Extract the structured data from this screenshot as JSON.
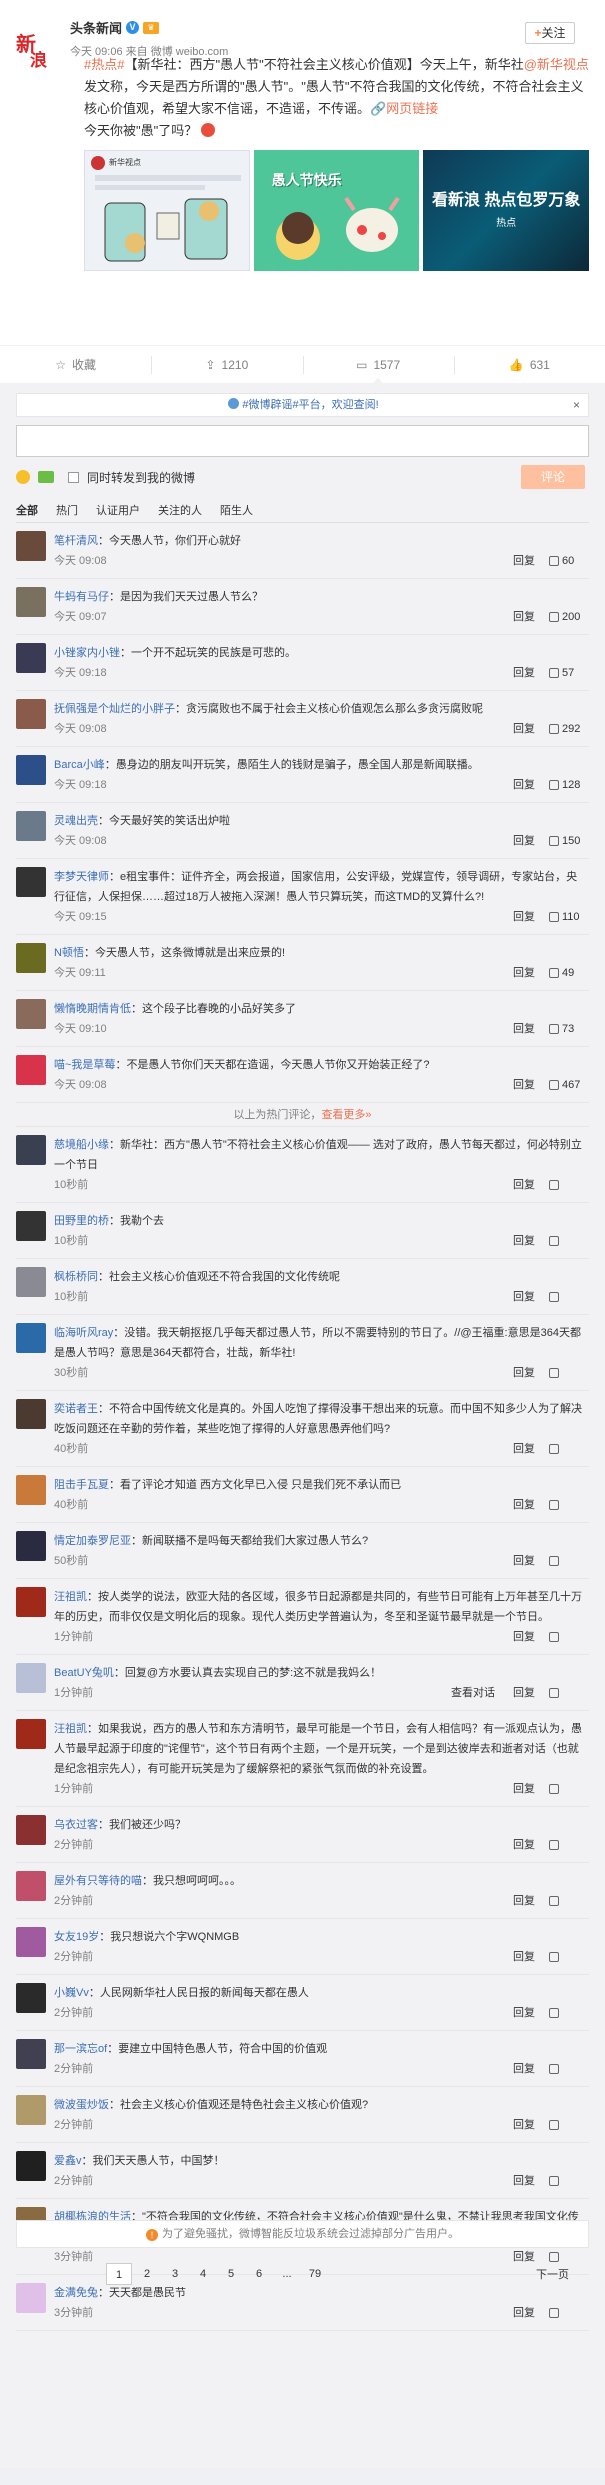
{
  "post": {
    "author": "头条新闻",
    "logo_text_1": "新",
    "logo_text_2": "浪",
    "meta": "今天 09:06 来自 微博 weibo.com",
    "follow_label": "关注",
    "text_parts": [
      "#热点#",
      "【新华社：西方\"愚人节\"不符社会主义核心价值观】今天上午，新华社",
      "@新华视点",
      " 发文称，今天是西方所谓的\"愚人节\"。\"愚人节\"不符合我国的文化传统，不符合社会主义核心价值观，希望大家不信谣，不造谣，不传谣。",
      "网页链接",
      "今天你被\"愚\"了吗？"
    ],
    "image2_text": "愚人节快乐",
    "image3_text": "看新浪 热点包罗万象",
    "image3_sub": "热点",
    "image1_header": "新华视点",
    "actions": {
      "favorite": "收藏",
      "repost": "1210",
      "comment": "1577",
      "like": "631"
    }
  },
  "comments": {
    "notice": "#微博辟谣#平台，欢迎查阅!",
    "notice_close": "×",
    "also_repost": "同时转发到我的微博",
    "submit": "评论",
    "tabs": [
      "全部",
      "热门",
      "认证用户",
      "关注的人",
      "陌生人"
    ],
    "reply": "回复",
    "view_conv": "查看对话",
    "hot": [
      {
        "name": "笔杆清风",
        "text": "今天愚人节，你们开心就好",
        "time": "今天 09:08",
        "likes": "60",
        "av": "#6a4a3a"
      },
      {
        "name": "牛蚂有马仔",
        "text": "是因为我们天天过愚人节么？",
        "time": "今天 09:07",
        "likes": "200",
        "av": "#7a7060"
      },
      {
        "name": "小锉家内小锉",
        "text": "一个开不起玩笑的民族是可悲的。",
        "time": "今天 09:18",
        "likes": "57",
        "av": "#3a3a55"
      },
      {
        "name": "抚佩强是个灿烂的小胖子",
        "text": "贪污腐败也不属于社会主义核心价值观怎么那么多贪污腐败呢",
        "time": "今天 09:08",
        "likes": "292",
        "av": "#8a5a4a"
      },
      {
        "name": "Barca小峰",
        "text": "愚身边的朋友叫开玩笑，愚陌生人的钱财是骗子，愚全国人那是新闻联播。",
        "time": "今天 09:18",
        "likes": "128",
        "av": "#2c4f8a"
      },
      {
        "name": "灵魂出壳",
        "text": "今天最好笑的笑话出炉啦",
        "time": "今天 09:08",
        "likes": "150",
        "av": "#6a7a8a"
      },
      {
        "name": "李梦天律师",
        "text": "e租宝事件：证件齐全，两会报道，国家信用，公安评级，党媒宣传，领导调研，专家站台，央行征信，人保担保……超过18万人被拖入深渊！愚人节只算玩笑，而这TMD的叉算什么?!",
        "time": "今天 09:15",
        "likes": "110",
        "av": "#333333"
      },
      {
        "name": "N顿悟",
        "text": "今天愚人节，这条微博就是出来应景的!",
        "time": "今天 09:11",
        "likes": "49",
        "av": "#6a6a20"
      },
      {
        "name": "懒惰晚期情肯低",
        "text": "这个段子比春晚的小品好笑多了",
        "time": "今天 09:10",
        "likes": "73",
        "av": "#8a6a5a"
      },
      {
        "name": "喵~我是草莓",
        "text": "不是愚人节你们天天都在造谣，今天愚人节你又开始装正经了?",
        "time": "今天 09:08",
        "likes": "467",
        "av": "#d8334a"
      }
    ],
    "hot_more_prefix": "以上为热门评论，",
    "hot_more_link": "查看更多»",
    "latest": [
      {
        "name": "慈境船小缘",
        "text": "新华社：西方\"愚人节\"不符社会主义核心价值观—— 选对了政府，愚人节每天都过，何必特别立一个节日",
        "time": "10秒前",
        "av": "#3a4050"
      },
      {
        "name": "田野里的桥",
        "text": "我勒个去",
        "time": "10秒前",
        "av": "#333333"
      },
      {
        "name": "枫栎桥同",
        "text": "社会主义核心价值观还不符合我国的文化传统呢",
        "time": "10秒前",
        "av": "#8a8a95"
      },
      {
        "name": "临海听风ray",
        "text": "没错。我天朝抠抠几乎每天都过愚人节，所以不需要特别的节日了。//@王福重:意思是364天都是愚人节吗？",
        "text2": "意思是364天都符合，壮哉，新华社!",
        "time": "30秒前",
        "av": "#2a6aa8"
      },
      {
        "name": "奕诺者王",
        "text": "不符合中国传统文化是真的。外国人吃饱了撑得没事干想出来的玩意。而中国不知多少人为了解决吃饭问题还在辛勤的劳作着，某些吃饱了撑得的人好意思愚弄他们吗?",
        "time": "40秒前",
        "av": "#4a3a30"
      },
      {
        "name": "阻击手瓦夏",
        "text": "看了评论才知道 西方文化早已入侵 只是我们死不承认而已",
        "time": "40秒前",
        "av": "#c97a3a"
      },
      {
        "name": "情定加泰罗尼亚",
        "text": "新闻联播不是吗每天都给我们大家过愚人节么?",
        "time": "50秒前",
        "av": "#2a2a40"
      },
      {
        "name": "汪祖凯",
        "text": "按人类学的说法，欧亚大陆的各区域，很多节日起源都是共同的，有些节日可能有上万年甚至几十万年的历史，而非仅仅是文明化后的现象。现代人类历史学普遍认为，冬至和圣诞节最早就是一个节日。",
        "time": "1分钟前",
        "av": "#a02a1a"
      },
      {
        "name": "BeatUY兔叽",
        "text": "回复@方水要认真去实现自己的梦:这不就是我妈么！",
        "time": "1分钟前",
        "view": true,
        "av": "#b8c0d8"
      },
      {
        "name": "汪祖凯",
        "text": "如果我说，西方的愚人节和东方清明节，最早可能是一个节日，会有人相信吗？有一派观点认为，愚人节最早起源于印度的\"诧俚节\"，这个节日有两个主题，一个是开玩笑，一个是到达彼岸去和逝者对话（也就是纪念祖宗先人），有可能开玩笑是为了缓解祭祀的紧张气氛而做的补充设置。",
        "time": "1分钟前",
        "av": "#a02a1a"
      },
      {
        "name": "乌衣过客",
        "text": "我们被还少吗？",
        "time": "2分钟前",
        "av": "#8a3030"
      },
      {
        "name": "屋外有只等待的喵",
        "text": "我只想呵呵呵。。。",
        "time": "2分钟前",
        "av": "#c0506a"
      },
      {
        "name": "女友19岁",
        "text": "我只想说六个字WQNMGB",
        "time": "2分钟前",
        "av": "#a05aa0"
      },
      {
        "name": "小巍Vv",
        "text": "人民网新华社人民日报的新闻每天都在愚人",
        "time": "2分钟前",
        "av": "#2a2a2a"
      },
      {
        "name": "那一滨忘of",
        "text": "要建立中国特色愚人节，符合中国的价值观",
        "time": "2分钟前",
        "av": "#404050"
      },
      {
        "name": "微波蛋炒饭",
        "text": "社会主义核心价值观还是特色社会主义核心价值观?",
        "time": "2分钟前",
        "av": "#b09a6a"
      },
      {
        "name": "爱鑫v",
        "text": "我们天天愚人节，中国梦！",
        "time": "2分钟前",
        "av": "#202020"
      },
      {
        "name": "胡椰栋浪的生活",
        "text": "\"不符合我国的文化传统，不符合社会主义核心价值观\"是什么鬼，不禁让我思考我国文化传统和社会主义核心价值观是什么 话说愚人节不是只在小学才玩儿的嘛，忽略该节日很多年",
        "time": "3分钟前",
        "av": "#8a6a40"
      },
      {
        "name": "金满免兔",
        "text": "天天都是愚民节",
        "time": "3分钟前",
        "av": "#e0c0e8"
      }
    ],
    "bottom_notice": "为了避免骚扰，微博智能反垃圾系统会过滤掉部分广告用户。",
    "pager": [
      "1",
      "2",
      "3",
      "4",
      "5",
      "6",
      "...",
      "79"
    ],
    "next": "下一页"
  }
}
